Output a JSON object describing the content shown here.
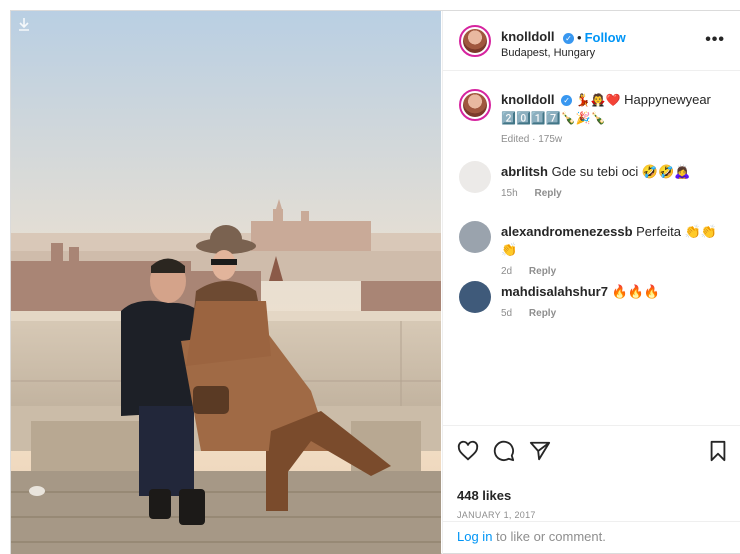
{
  "post": {
    "author": {
      "username": "knolldoll",
      "verified_icon": "verified-badge-icon",
      "location": "Budapest, Hungary"
    },
    "follow_label": "Follow",
    "more_icon": "more-horizontal-icon",
    "caption": {
      "username": "knolldoll",
      "emoji_prefix": "💃🧛❤️",
      "text": "Happynewyear",
      "emoji_line": "2️⃣0️⃣1️⃣7️⃣🍾🎉🍾",
      "meta": "Edited · 175w"
    },
    "comments": [
      {
        "username": "abrlitsh",
        "text": "Gde su tebi oci 🤣🤣🙇‍♀️",
        "time": "15h",
        "reply": "Reply"
      },
      {
        "username": "alexandromenezessb",
        "text": "Perfeita 👏👏👏",
        "time": "2d",
        "reply": "Reply"
      },
      {
        "username": "mahdisalahshur7",
        "text": "🔥🔥🔥",
        "time": "5d",
        "reply": "Reply"
      }
    ],
    "likes": "448 likes",
    "date": "JANUARY 1, 2017",
    "login": {
      "link": "Log in",
      "rest": " to like or comment."
    }
  },
  "colors": {
    "link_blue": "#0095f6",
    "muted_gray": "#8e8e8e",
    "text": "#262626",
    "avatar_ring": "#d6249f"
  }
}
